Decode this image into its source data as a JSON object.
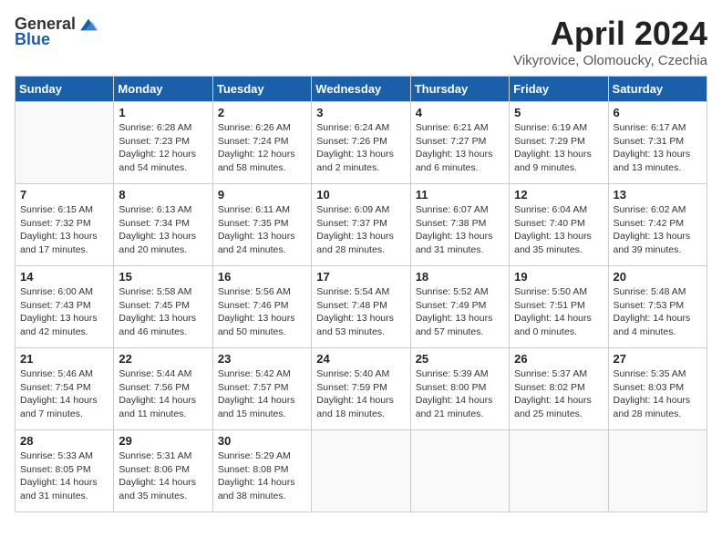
{
  "logo": {
    "general": "General",
    "blue": "Blue"
  },
  "title": "April 2024",
  "subtitle": "Vikyrovice, Olomoucky, Czechia",
  "weekdays": [
    "Sunday",
    "Monday",
    "Tuesday",
    "Wednesday",
    "Thursday",
    "Friday",
    "Saturday"
  ],
  "weeks": [
    [
      {
        "day": "",
        "info": ""
      },
      {
        "day": "1",
        "info": "Sunrise: 6:28 AM\nSunset: 7:23 PM\nDaylight: 12 hours\nand 54 minutes."
      },
      {
        "day": "2",
        "info": "Sunrise: 6:26 AM\nSunset: 7:24 PM\nDaylight: 12 hours\nand 58 minutes."
      },
      {
        "day": "3",
        "info": "Sunrise: 6:24 AM\nSunset: 7:26 PM\nDaylight: 13 hours\nand 2 minutes."
      },
      {
        "day": "4",
        "info": "Sunrise: 6:21 AM\nSunset: 7:27 PM\nDaylight: 13 hours\nand 6 minutes."
      },
      {
        "day": "5",
        "info": "Sunrise: 6:19 AM\nSunset: 7:29 PM\nDaylight: 13 hours\nand 9 minutes."
      },
      {
        "day": "6",
        "info": "Sunrise: 6:17 AM\nSunset: 7:31 PM\nDaylight: 13 hours\nand 13 minutes."
      }
    ],
    [
      {
        "day": "7",
        "info": "Sunrise: 6:15 AM\nSunset: 7:32 PM\nDaylight: 13 hours\nand 17 minutes."
      },
      {
        "day": "8",
        "info": "Sunrise: 6:13 AM\nSunset: 7:34 PM\nDaylight: 13 hours\nand 20 minutes."
      },
      {
        "day": "9",
        "info": "Sunrise: 6:11 AM\nSunset: 7:35 PM\nDaylight: 13 hours\nand 24 minutes."
      },
      {
        "day": "10",
        "info": "Sunrise: 6:09 AM\nSunset: 7:37 PM\nDaylight: 13 hours\nand 28 minutes."
      },
      {
        "day": "11",
        "info": "Sunrise: 6:07 AM\nSunset: 7:38 PM\nDaylight: 13 hours\nand 31 minutes."
      },
      {
        "day": "12",
        "info": "Sunrise: 6:04 AM\nSunset: 7:40 PM\nDaylight: 13 hours\nand 35 minutes."
      },
      {
        "day": "13",
        "info": "Sunrise: 6:02 AM\nSunset: 7:42 PM\nDaylight: 13 hours\nand 39 minutes."
      }
    ],
    [
      {
        "day": "14",
        "info": "Sunrise: 6:00 AM\nSunset: 7:43 PM\nDaylight: 13 hours\nand 42 minutes."
      },
      {
        "day": "15",
        "info": "Sunrise: 5:58 AM\nSunset: 7:45 PM\nDaylight: 13 hours\nand 46 minutes."
      },
      {
        "day": "16",
        "info": "Sunrise: 5:56 AM\nSunset: 7:46 PM\nDaylight: 13 hours\nand 50 minutes."
      },
      {
        "day": "17",
        "info": "Sunrise: 5:54 AM\nSunset: 7:48 PM\nDaylight: 13 hours\nand 53 minutes."
      },
      {
        "day": "18",
        "info": "Sunrise: 5:52 AM\nSunset: 7:49 PM\nDaylight: 13 hours\nand 57 minutes."
      },
      {
        "day": "19",
        "info": "Sunrise: 5:50 AM\nSunset: 7:51 PM\nDaylight: 14 hours\nand 0 minutes."
      },
      {
        "day": "20",
        "info": "Sunrise: 5:48 AM\nSunset: 7:53 PM\nDaylight: 14 hours\nand 4 minutes."
      }
    ],
    [
      {
        "day": "21",
        "info": "Sunrise: 5:46 AM\nSunset: 7:54 PM\nDaylight: 14 hours\nand 7 minutes."
      },
      {
        "day": "22",
        "info": "Sunrise: 5:44 AM\nSunset: 7:56 PM\nDaylight: 14 hours\nand 11 minutes."
      },
      {
        "day": "23",
        "info": "Sunrise: 5:42 AM\nSunset: 7:57 PM\nDaylight: 14 hours\nand 15 minutes."
      },
      {
        "day": "24",
        "info": "Sunrise: 5:40 AM\nSunset: 7:59 PM\nDaylight: 14 hours\nand 18 minutes."
      },
      {
        "day": "25",
        "info": "Sunrise: 5:39 AM\nSunset: 8:00 PM\nDaylight: 14 hours\nand 21 minutes."
      },
      {
        "day": "26",
        "info": "Sunrise: 5:37 AM\nSunset: 8:02 PM\nDaylight: 14 hours\nand 25 minutes."
      },
      {
        "day": "27",
        "info": "Sunrise: 5:35 AM\nSunset: 8:03 PM\nDaylight: 14 hours\nand 28 minutes."
      }
    ],
    [
      {
        "day": "28",
        "info": "Sunrise: 5:33 AM\nSunset: 8:05 PM\nDaylight: 14 hours\nand 31 minutes."
      },
      {
        "day": "29",
        "info": "Sunrise: 5:31 AM\nSunset: 8:06 PM\nDaylight: 14 hours\nand 35 minutes."
      },
      {
        "day": "30",
        "info": "Sunrise: 5:29 AM\nSunset: 8:08 PM\nDaylight: 14 hours\nand 38 minutes."
      },
      {
        "day": "",
        "info": ""
      },
      {
        "day": "",
        "info": ""
      },
      {
        "day": "",
        "info": ""
      },
      {
        "day": "",
        "info": ""
      }
    ]
  ]
}
